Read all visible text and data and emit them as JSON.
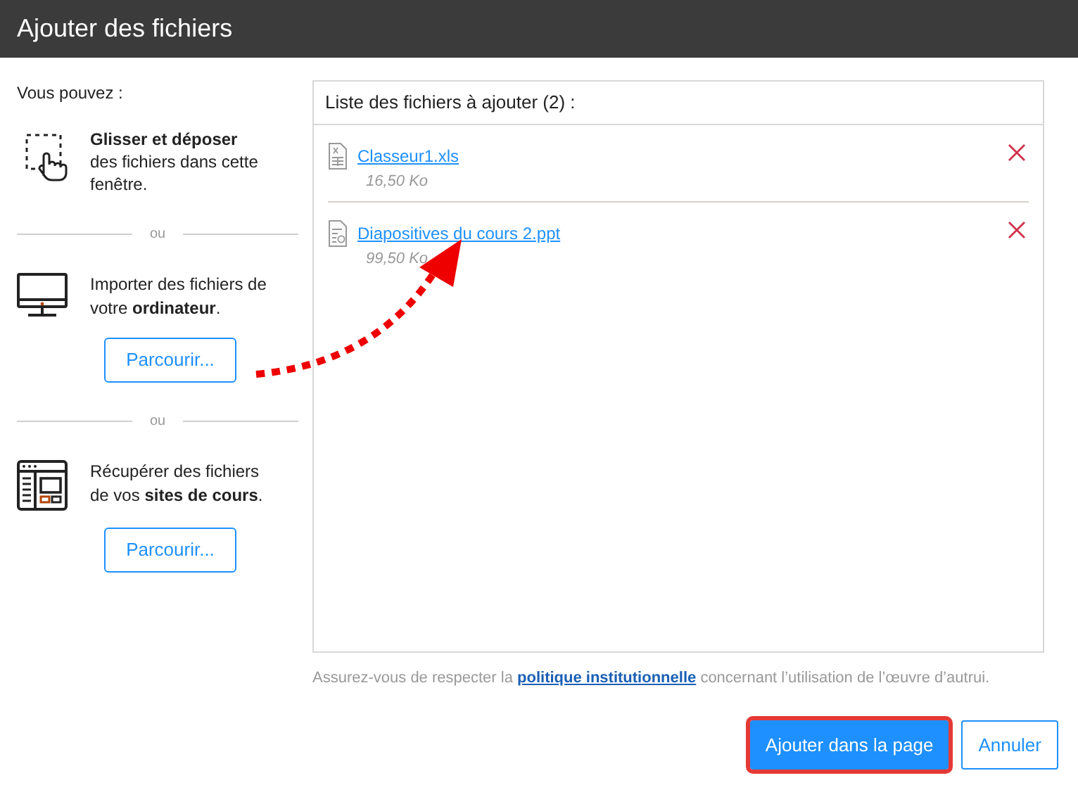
{
  "window": {
    "title": "Ajouter des fichiers"
  },
  "left": {
    "intro": "Vous pouvez :",
    "drop": {
      "text": "**Glisser et déposer** des fichiers dans cette fenêtre."
    },
    "separators": [
      "ou",
      "ou"
    ],
    "sources": [
      {
        "kind": "computer",
        "text": "Importer des fichiers de votre **ordinateur**.",
        "button": "Parcourir..."
      },
      {
        "kind": "courses",
        "text": "Récupérer des fichiers de vos **sites de cours**.",
        "button": "Parcourir..."
      }
    ]
  },
  "file_list": {
    "title": "Liste des fichiers à ajouter (2) :",
    "files": [
      {
        "kind": "spreadsheet",
        "name": "Classeur1.xls",
        "size": "16,50 Ko"
      },
      {
        "kind": "presentation",
        "name": "Diapositives du cours 2.ppt",
        "size": "99,50 Ko"
      }
    ]
  },
  "notice": {
    "before": "Assurez-vous de respecter la",
    "link": "politique institutionnelle",
    "after": "concernant l’utilisation de l’œuvre d’autrui."
  },
  "buttons": [
    {
      "kind": "primary",
      "label": "Ajouter dans la page",
      "highlighted": true
    },
    {
      "kind": "secondary",
      "label": "Annuler",
      "highlighted": false
    }
  ]
}
